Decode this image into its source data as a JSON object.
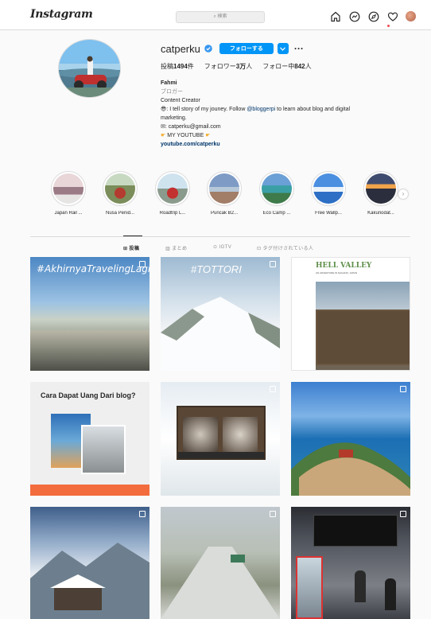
{
  "nav": {
    "logo": "Instagram",
    "search_placeholder": "検索",
    "icons": [
      "home-icon",
      "messenger-icon",
      "explore-icon",
      "heart-icon",
      "avatar"
    ]
  },
  "profile": {
    "username": "catperku",
    "follow_label": "フォローする",
    "stats": [
      {
        "label": "投稿",
        "value": "1494",
        "suffix": "件"
      },
      {
        "label": "フォロワー",
        "value": "3万",
        "suffix": "人"
      },
      {
        "label": "フォロー中",
        "value": "842",
        "suffix": "人"
      }
    ],
    "bio": {
      "name": "Fahmi",
      "category": "ブロガー",
      "line1": "Content Creator",
      "line2_pre": ": I tell story of my jouney. Follow ",
      "line2_mention": "@bloggerpi",
      "line2_post": " to learn about blog and digital",
      "line3": "marketing.",
      "line4": ": catperku@gmail.com",
      "line5": "MY YOUTUBE",
      "link": "youtube.com/catperku"
    }
  },
  "highlights": [
    {
      "label": "Japan Rail ..."
    },
    {
      "label": "Nusa Penid..."
    },
    {
      "label": "Roadtrip L..."
    },
    {
      "label": "Puncak B2..."
    },
    {
      "label": "Eco Camp ..."
    },
    {
      "label": "Free Wallp..."
    },
    {
      "label": "Kakunodat..."
    }
  ],
  "tabs": [
    {
      "label": "投稿",
      "active": true
    },
    {
      "label": "まとめ",
      "active": false
    },
    {
      "label": "IGTV",
      "active": false
    },
    {
      "label": "タグ付けされている人",
      "active": false
    }
  ],
  "posts": {
    "p1_caption": "#AkhirnyaTravelingLagi",
    "p2_caption": "#TOTTORI",
    "p3_title": "HELL VALLEY",
    "p3_sub": "AN ADVENTURE IN NAGANO, JAPAN",
    "p4_title": "Cara Dapat Uang Dari blog?"
  },
  "colors": {
    "primary_blue": "#0095f6",
    "link_blue": "#00376b",
    "border": "#dbdbdb",
    "muted": "#8e8e8e"
  }
}
